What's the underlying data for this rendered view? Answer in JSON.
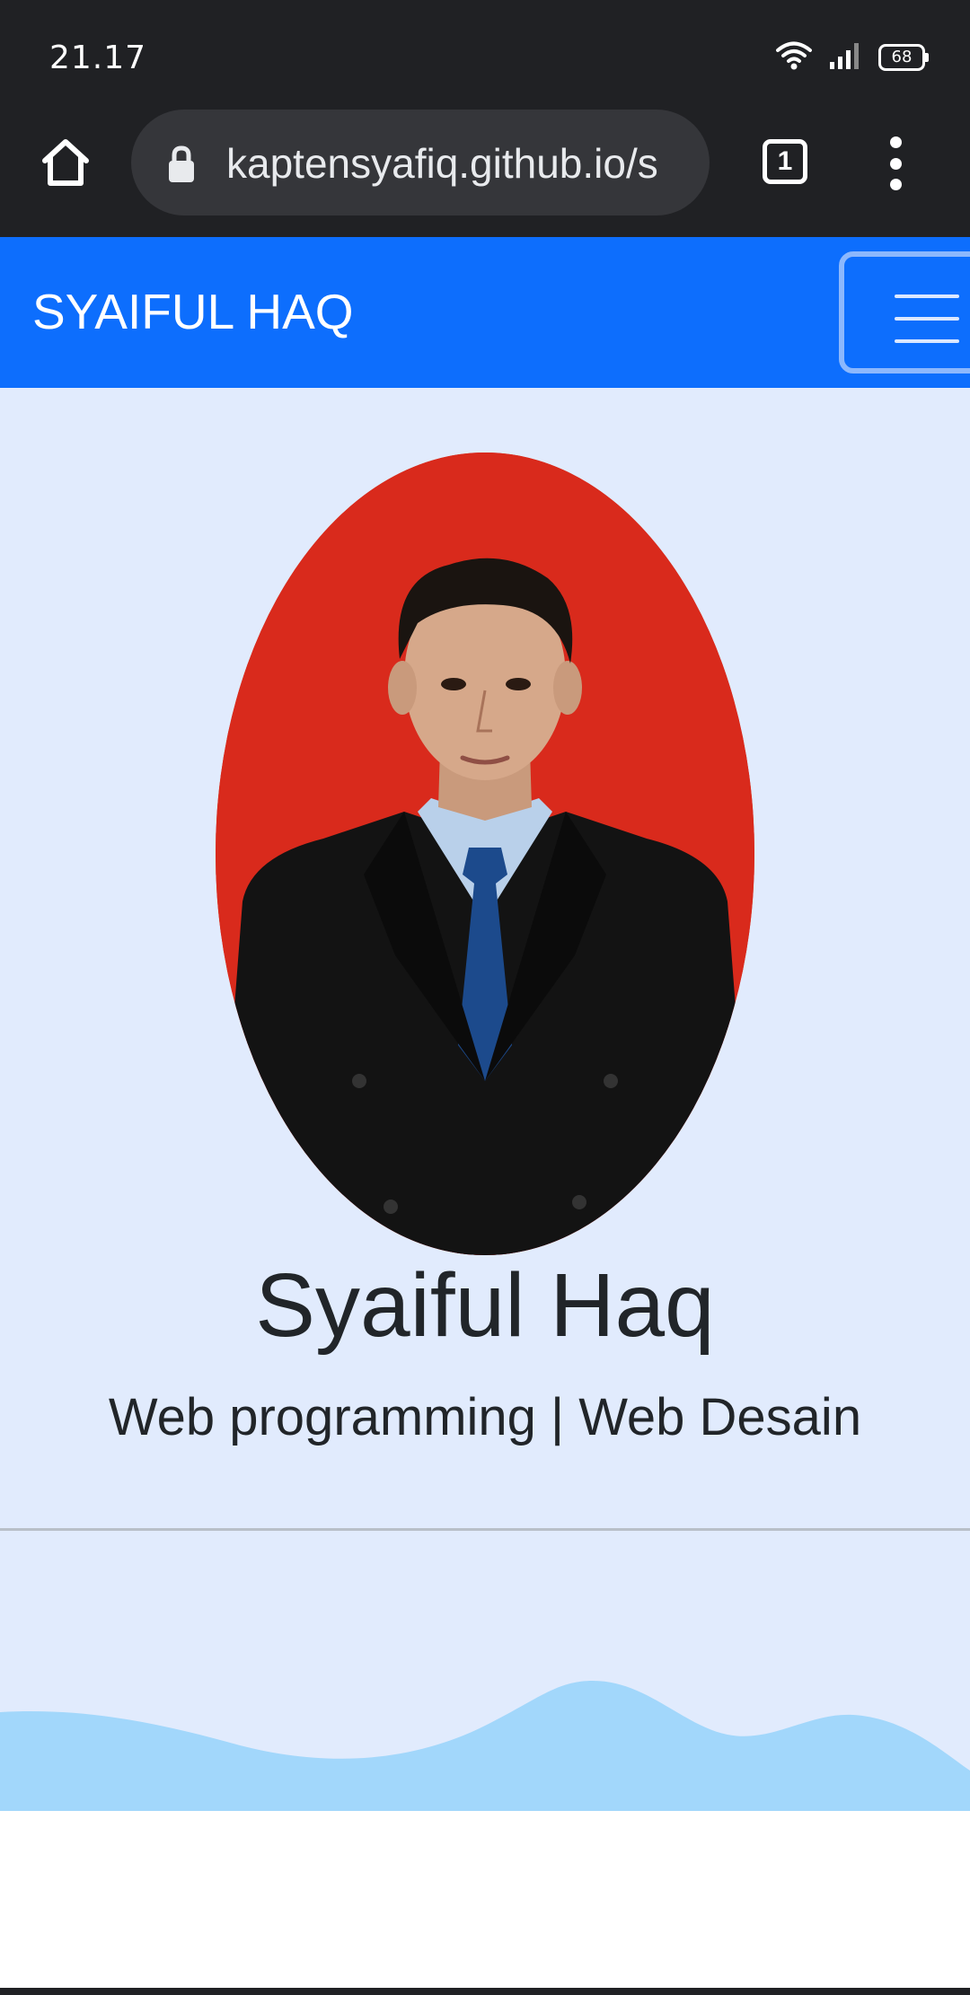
{
  "status_bar": {
    "time": "21.17",
    "battery_level": "68",
    "icons": [
      "wifi-icon",
      "signal-icon",
      "battery-icon"
    ]
  },
  "browser": {
    "url": "kaptensyafiq.github.io/s",
    "tab_count": "1",
    "icons": [
      "home-icon",
      "lock-icon",
      "tabs-icon",
      "more-vert-icon"
    ]
  },
  "navbar": {
    "brand": "SYAIFUL HAQ",
    "color": "#0d6efd",
    "toggler_icon": "hamburger-menu-icon"
  },
  "hero": {
    "background": "#e1ebfd",
    "name": "Syaiful Haq",
    "subtitle": "Web programming | Web Desain",
    "wave_color": "#a2d7fb"
  }
}
